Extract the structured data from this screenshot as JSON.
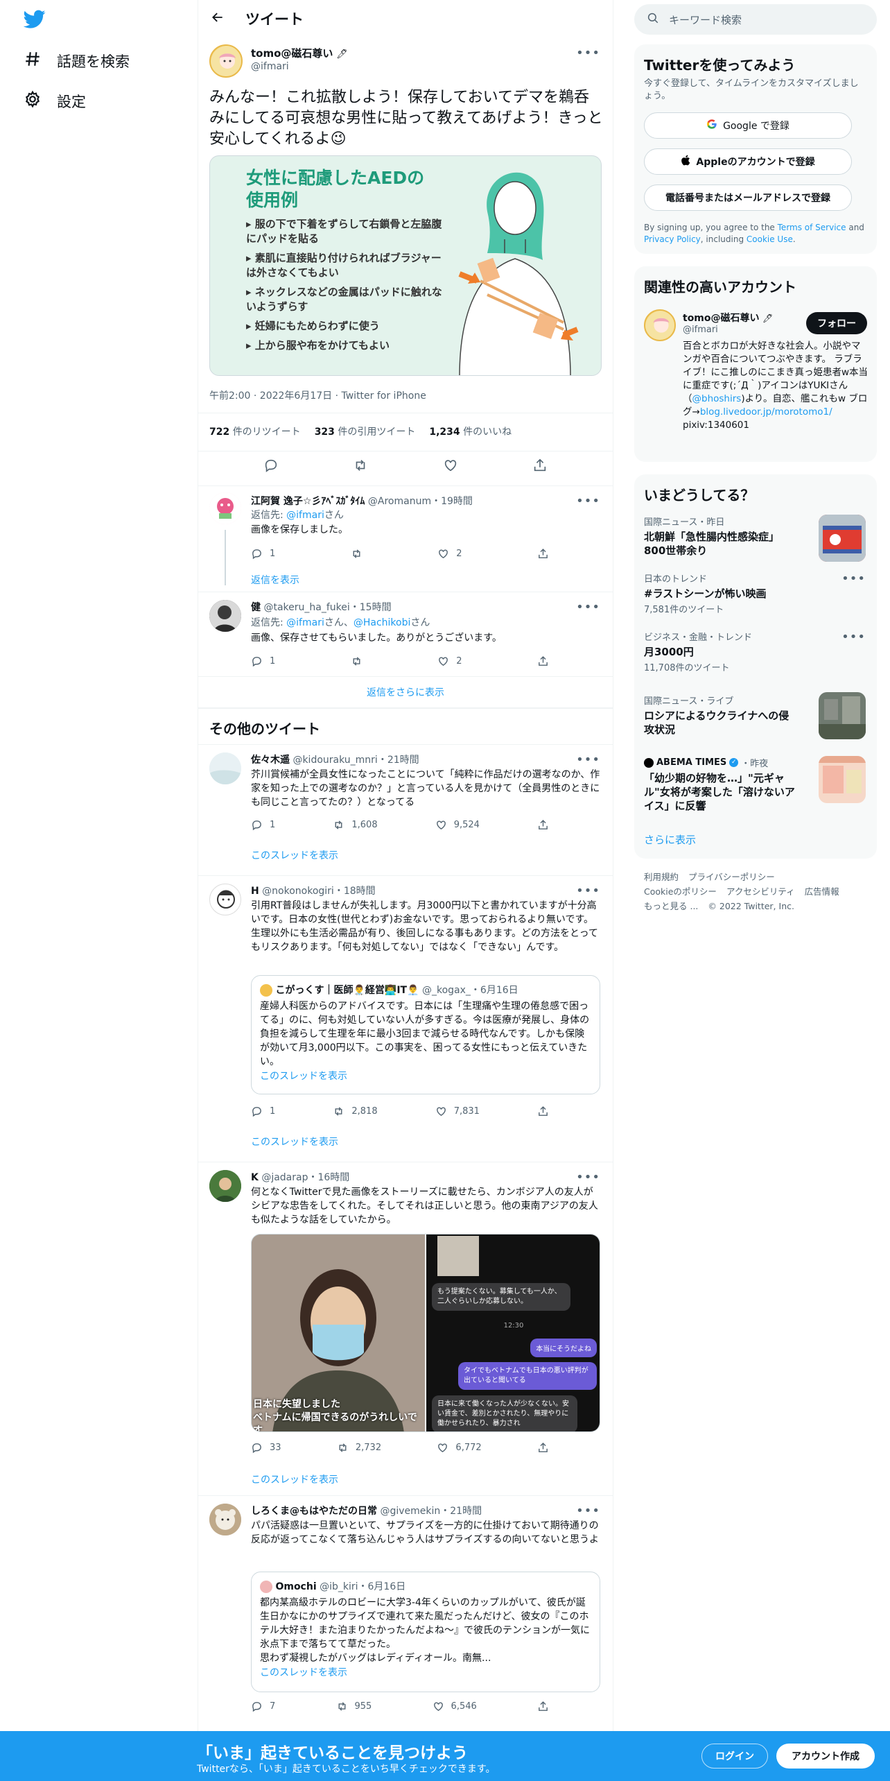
{
  "nav": {
    "explore": "話題を検索",
    "settings": "設定"
  },
  "header": {
    "title": "ツイート"
  },
  "tweet": {
    "name": "tomo@磁石尊い",
    "handle": "@ifmari",
    "text": "みんなー！これ拡散しよう！保存しておいてデマを鵜呑みにしてる可哀想な男性に貼って教えてあげよう！きっと安心してくれるよ😉",
    "image": {
      "title1": "女性に配慮したAEDの",
      "title2": "使用例",
      "bullets": [
        "服の下で下着をずらして右鎖骨と左脇腹にパッドを貼る",
        "素肌に直接貼り付けられればブラジャーは外さなくてもよい",
        "ネックレスなどの金属はパッドに触れないようずらす",
        "妊婦にもためらわずに使う",
        "上から服や布をかけてもよい"
      ]
    },
    "time": "午前2:00 · 2022年6月17日 · Twitter for iPhone",
    "retweets": "722",
    "retweets_label": "件のリツイート",
    "quotes": "323",
    "quotes_label": "件の引用ツイート",
    "likes": "1,234",
    "likes_label": "件のいいね"
  },
  "replies": [
    {
      "name": "江阿賀 逸子☆彡ｱﾍﾞｽｶﾞﾀｲﾑ",
      "handle": "@Aromanum",
      "time": "・19時間",
      "reply_to_label": "返信先: ",
      "reply_to": "@ifmari",
      "reply_suffix": "さん",
      "text": "画像を保存しました。",
      "replies": "1",
      "likes": "2",
      "show": "返信を表示"
    },
    {
      "name": "健",
      "handle": "@takeru_ha_fukei",
      "time": "・15時間",
      "reply_to_label": "返信先: ",
      "reply_to": "@ifmari",
      "reply_mid": "さん、",
      "reply_to2": "@Hachikobi",
      "reply_suffix": "さん",
      "text": "画像、保存させてもらいました。ありがとうございます。",
      "replies": "1",
      "likes": "2"
    }
  ],
  "more_replies": "返信をさらに表示",
  "other_title": "その他のツイート",
  "others": [
    {
      "name": "佐々木遥",
      "handle": "@kidouraku_mnri",
      "time": "・21時間",
      "text": "芥川賞候補が全員女性になったことについて「純粋に作品だけの選考なのか、作家を知った上での選考なのか？」と言っている人を見かけて（全員男性のときにも同じこと言ってたの？）となってる",
      "replies": "1",
      "retweets": "1,608",
      "likes": "9,524",
      "thread": "このスレッドを表示"
    },
    {
      "name": "H",
      "handle": "@nokonokogiri",
      "time": "・18時間",
      "text": "引用RT普段はしませんが失礼します。月3000円以下と書かれていますが十分高いです。日本の女性(世代とわず)お金ないです。思っておられるより無いです。生理以外にも生活必需品が有り、後回しになる事もあります。どの方法をとってもリスクあります。「何も対処してない」ではなく「できない」んです。",
      "quote": {
        "name": "こがっくす｜医師👨‍⚕️経営👨‍💻IT👨‍💼",
        "handle": "@_kogax_",
        "time": "・6月16日",
        "text": "産婦人科医からのアドバイスです。日本には「生理痛や生理の倦怠感で困ってる」のに、何も対処していない人が多すぎる。今は医療が発展し、身体の負担を減らして生理を年に最小3回まで減らせる時代なんです。しかも保険が効いて月3,000円以下。この事実を、困ってる女性にもっと伝えていきたい。",
        "thread": "このスレッドを表示"
      },
      "replies": "1",
      "retweets": "2,818",
      "likes": "7,831",
      "thread": "このスレッドを表示"
    },
    {
      "name": "K",
      "handle": "@jadarap",
      "time": "・16時間",
      "text": "何となくTwitterで見た画像をストーリーズに載せたら、カンボジア人の友人がシビアな忠告をしてくれた。そしてそれは正しいと思う。他の東南アジアの友人も似たような話をしていたから。",
      "img_caption": "日本に失望しました\nベトナムに帰国できるのがうれしいです",
      "chat": [
        "もう提案たくない。募集しても一人か、二人ぐらいしか応募しない。",
        "12:30",
        "本当にそうだよね",
        "タイでもベトナムでも日本の悪い評判が出ていると聞いてる",
        "日本に来て働くなった人が少なくない。安い賃金で、差別とかされたり、無理やりに働かせられたり、暴力され"
      ],
      "replies": "33",
      "retweets": "2,732",
      "likes": "6,772",
      "thread": "このスレッドを表示"
    },
    {
      "name": "しろくま@もはやただの日常",
      "handle": "@givemekin",
      "time": "・21時間",
      "text": "パパ活疑惑は一旦置いといて、サプライズを一方的に仕掛けておいて期待通りの反応が返ってこなくて落ち込んじゃう人はサプライズするの向いてないと思うよ",
      "quote": {
        "name": "Omochi",
        "handle": "@ib_kiri",
        "time": "・6月16日",
        "text": "都内某高級ホテルのロビーに大学3-4年くらいのカップルがいて、彼氏が誕生日かなにかのサプライズで連れて来た風だったんだけど、彼女の『このホテル大好き！また泊まりたかったんだよね〜』で彼氏のテンションが一気に氷点下まで落ちてて草だった。\n思わず凝視したがバッグはレディディオール。南無...",
        "thread": "このスレッドを表示"
      },
      "replies": "7",
      "retweets": "955",
      "likes": "6,546"
    }
  ],
  "right": {
    "search_placeholder": "キーワード検索",
    "signup": {
      "title": "Twitterを使ってみよう",
      "sub": "今すぐ登録して、タイムラインをカスタマイズしましょう。",
      "google": "Google で登録",
      "apple": "Appleのアカウントで登録",
      "phone": "電話番号またはメールアドレスで登録",
      "terms1": "By signing up, you agree to the ",
      "terms_link": "Terms of Service",
      "terms2": " and ",
      "privacy": "Privacy Policy",
      "terms3": ", including ",
      "cookie": "Cookie Use",
      "terms4": "."
    },
    "related": {
      "title": "関連性の高いアカウント",
      "name": "tomo@磁石尊い",
      "handle": "@ifmari",
      "follow": "フォロー",
      "bio": "百合とボカロが大好きな社会人。小説やマンガや百合についてつぶやきます。 ラブライブ！にこ推しのにこまき真っ姫患者w本当に重症です(;´Д｀)アイコンはYUKIさん（",
      "bio_link": "@bhoshirs",
      "bio2": ")より。自恋、艦これもw ブログ→",
      "blog": "blog.livedoor.jp/morotomo1/",
      "pixiv": "pixiv:1340601"
    },
    "trends": {
      "title": "いまどうしてる？",
      "items": [
        {
          "meta": "国際ニュース・昨日",
          "title": "北朝鮮「急性腸内性感染症」800世帯余り"
        },
        {
          "meta": "日本のトレンド",
          "title": "#ラストシーンが怖い映画",
          "sub": "7,581件のツイート"
        },
        {
          "meta": "ビジネス・金融・トレンド",
          "title": "月3000円",
          "sub": "11,708件のツイート"
        },
        {
          "meta": "国際ニュース・ライブ",
          "title": "ロシアによるウクライナへの侵攻状況"
        },
        {
          "meta_source": "ABEMA TIMES",
          "meta_time": "・昨夜",
          "title": "「幼少期の好物を…」\"元ギャル\"女将が考案した「溶けないアイス」に反響"
        }
      ],
      "more": "さらに表示"
    },
    "footer": {
      "l1": [
        "利用規約",
        "プライバシーポリシー"
      ],
      "l2": [
        "Cookieのポリシー",
        "アクセシビリティ",
        "広告情報"
      ],
      "l3": "もっと見る ...",
      "copy": "© 2022 Twitter, Inc."
    }
  },
  "bottom": {
    "title": "「いま」起きていることを見つけよう",
    "sub": "Twitterなら、「いま」起きていることをいち早くチェックできます。",
    "login": "ログイン",
    "signup": "アカウント作成"
  },
  "colors": {
    "accent": "#1d9bf0",
    "text": "#0f1419",
    "muted": "#536471",
    "border": "#eff3f4",
    "aed_bg": "#e3f3ec",
    "aed_title": "#1e9b7a"
  }
}
